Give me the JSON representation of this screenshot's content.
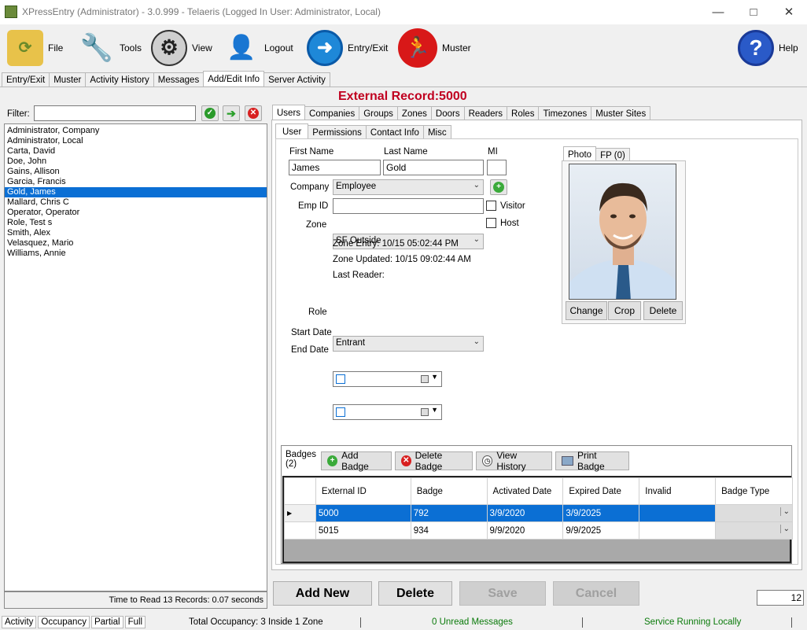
{
  "window": {
    "title": "XPressEntry (Administrator)  - 3.0.999 - Telaeris (Logged In User: Administrator, Local)"
  },
  "toolbar": {
    "file": "File",
    "tools": "Tools",
    "view": "View",
    "logout": "Logout",
    "entry_exit": "Entry/Exit",
    "muster": "Muster",
    "help": "Help"
  },
  "top_tabs": [
    "Entry/Exit",
    "Muster",
    "Activity History",
    "Messages",
    "Add/Edit Info",
    "Server Activity"
  ],
  "external_record": "External Record:5000",
  "filter": {
    "label": "Filter:",
    "value": ""
  },
  "users": [
    "Administrator, Company",
    "Administrator, Local",
    "Carta, David",
    "Doe, John",
    "Gains, Allison",
    "Garcia, Francis",
    "Gold, James",
    "Mallard, Chris C",
    "Operator, Operator",
    "Role, Test s",
    "Smith, Alex",
    "Velasquez, Mario",
    "Williams, Annie"
  ],
  "list_footer": "Time to Read 13 Records: 0.07 seconds",
  "entity_tabs": [
    "Users",
    "Companies",
    "Groups",
    "Zones",
    "Doors",
    "Readers",
    "Roles",
    "Timezones",
    "Muster Sites"
  ],
  "user_tabs": [
    "User",
    "Permissions",
    "Contact Info",
    "Misc"
  ],
  "form": {
    "first_name_label": "First Name",
    "last_name_label": "Last Name",
    "mi_label": "MI",
    "first_name": "James",
    "last_name": "Gold",
    "mi": "",
    "company_label": "Company",
    "company": "Employee",
    "emp_id_label": "Emp ID",
    "emp_id": "",
    "visitor_label": "Visitor",
    "host_label": "Host",
    "zone_label": "Zone",
    "zone": "SF Outside",
    "zone_entry": "Zone Entry: 10/15 05:02:44 PM",
    "zone_updated": "Zone Updated: 10/15 09:02:44 AM",
    "last_reader": "Last Reader:",
    "role_label": "Role",
    "role": "Entrant",
    "start_date_label": "Start Date",
    "end_date_label": "End Date"
  },
  "photo": {
    "tabs": [
      "Photo",
      "FP (0)"
    ],
    "change": "Change",
    "crop": "Crop",
    "delete": "Delete"
  },
  "badges": {
    "label_line1": "Badges",
    "label_line2": "(2)",
    "add": "Add Badge",
    "delete": "Delete Badge",
    "history": "View History",
    "print": "Print Badge",
    "columns": [
      "External ID",
      "Badge",
      "Activated Date",
      "Expired Date",
      "Invalid",
      "Badge Type"
    ],
    "rows": [
      {
        "external_id": "5000",
        "badge": "792",
        "activated": "3/9/2020",
        "expired": "3/9/2025",
        "invalid": "",
        "badge_type": ""
      },
      {
        "external_id": "5015",
        "badge": "934",
        "activated": "9/9/2020",
        "expired": "9/9/2025",
        "invalid": "",
        "badge_type": ""
      }
    ]
  },
  "actions": {
    "add_new": "Add New",
    "delete": "Delete",
    "save": "Save",
    "cancel": "Cancel"
  },
  "page_box_value": "12",
  "status": {
    "tabs": [
      "Activity",
      "Occupancy",
      "Partial",
      "Full"
    ],
    "occupancy": "Total Occupancy: 3 Inside 1 Zone",
    "messages": "0 Unread Messages",
    "service": "Service Running Locally"
  },
  "colors": {
    "accent": "#0b6fd4",
    "record": "#c00020",
    "service": "#0a7a0a",
    "messages": "#0a7a0a"
  }
}
